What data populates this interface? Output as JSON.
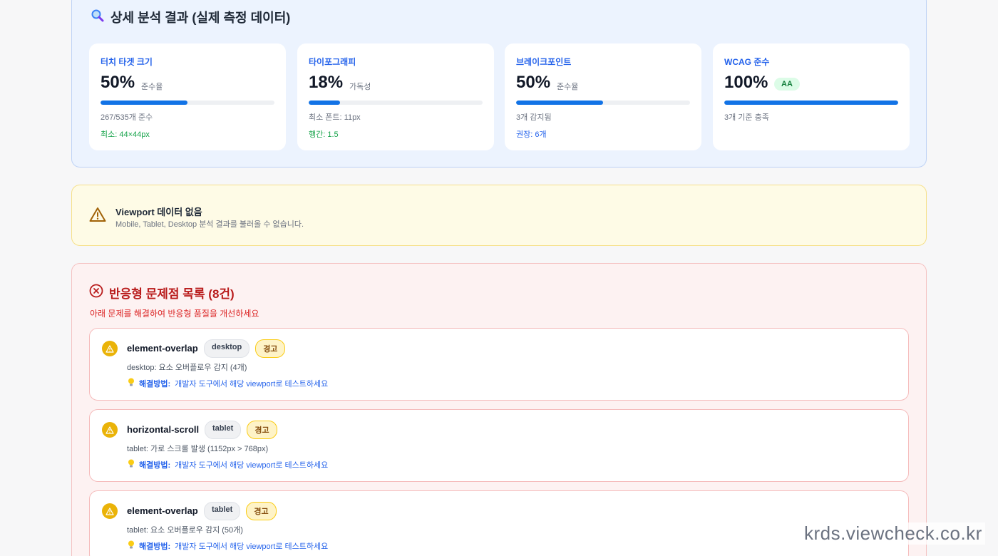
{
  "analysis": {
    "title": "상세 분석 결과 (실제 측정 데이터)",
    "icon": "magnifier-icon",
    "metrics": [
      {
        "title": "터치 타겟 크기",
        "value": "50%",
        "unit": "준수율",
        "progress": 0.5,
        "detail": "267/535개 준수",
        "extra": "최소: 44×44px",
        "extra_color": "#16a34a"
      },
      {
        "title": "타이포그래피",
        "value": "18%",
        "unit": "가독성",
        "progress": 0.18,
        "detail": "최소 폰트: 11px",
        "extra": "행간: 1.5",
        "extra_color": "#16a34a"
      },
      {
        "title": "브레이크포인트",
        "value": "50%",
        "unit": "준수율",
        "progress": 0.5,
        "detail": "3개 감지됨",
        "extra": "권장: 6개",
        "extra_color": "#2563eb"
      },
      {
        "title": "WCAG 준수",
        "value": "100%",
        "badge": "AA",
        "progress": 1.0,
        "detail": "3개 기준 충족"
      }
    ]
  },
  "viewport_notice": {
    "icon": "warning-triangle-icon",
    "title": "Viewport 데이터 없음",
    "message": "Mobile, Tablet, Desktop 분석 결과를 불러올 수 없습니다."
  },
  "issues": {
    "icon": "error-circle-icon",
    "title": "반응형 문제점 목록 (8건)",
    "subtitle": "아래 문제를 해결하여 반응형 품질을 개선하세요",
    "fix_label": "해결방법:",
    "items": [
      {
        "name": "element-overlap",
        "viewport": "desktop",
        "severity": "경고",
        "description": "desktop: 요소 오버플로우 감지 (4개)",
        "fix": "개발자 도구에서 해당 viewport로 테스트하세요"
      },
      {
        "name": "horizontal-scroll",
        "viewport": "tablet",
        "severity": "경고",
        "description": "tablet: 가로 스크롤 발생 (1152px > 768px)",
        "fix": "개발자 도구에서 해당 viewport로 테스트하세요"
      },
      {
        "name": "element-overlap",
        "viewport": "tablet",
        "severity": "경고",
        "description": "tablet: 요소 오버플로우 감지 (50개)",
        "fix": "개발자 도구에서 해당 viewport로 테스트하세요"
      }
    ]
  },
  "watermark": "krds.viewcheck.co.kr"
}
